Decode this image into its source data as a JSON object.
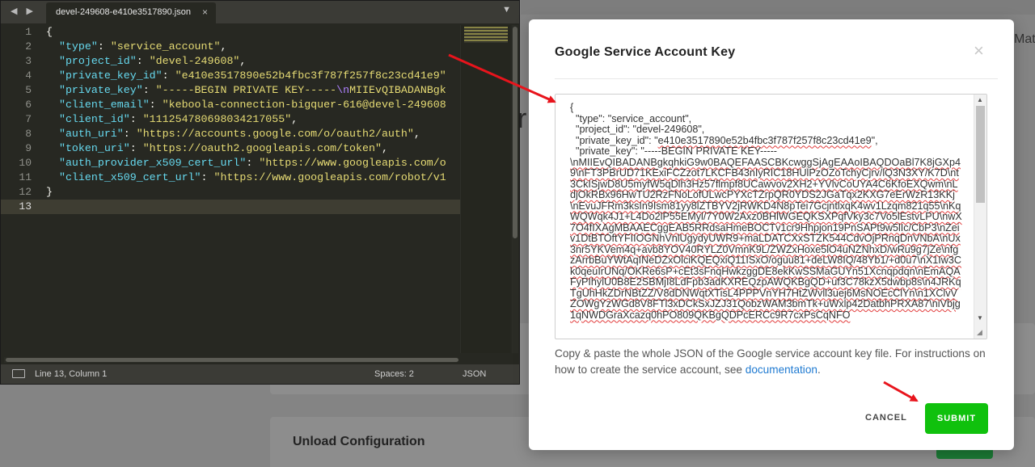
{
  "editor": {
    "tab_title": "devel-249608-e410e3517890.json",
    "tab_close": "×",
    "nav_arrows": "◀ ▶",
    "menu_icon": "▼",
    "line_numbers": [
      "1",
      "2",
      "3",
      "4",
      "5",
      "6",
      "7",
      "8",
      "9",
      "10",
      "11",
      "12",
      "13"
    ],
    "lines": [
      [
        {
          "t": "{",
          "c": "p"
        }
      ],
      [
        {
          "t": "  \"type\"",
          "c": "k"
        },
        {
          "t": ": ",
          "c": "p"
        },
        {
          "t": "\"service_account\"",
          "c": "s"
        },
        {
          "t": ",",
          "c": "p"
        }
      ],
      [
        {
          "t": "  \"project_id\"",
          "c": "k"
        },
        {
          "t": ": ",
          "c": "p"
        },
        {
          "t": "\"devel-249608\"",
          "c": "s"
        },
        {
          "t": ",",
          "c": "p"
        }
      ],
      [
        {
          "t": "  \"private_key_id\"",
          "c": "k"
        },
        {
          "t": ": ",
          "c": "p"
        },
        {
          "t": "\"e410e3517890e52b4fbc3f787f257f8c23cd41e9\"",
          "c": "s"
        }
      ],
      [
        {
          "t": "  \"private_key\"",
          "c": "k"
        },
        {
          "t": ": ",
          "c": "p"
        },
        {
          "t": "\"-----BEGIN PRIVATE KEY-----",
          "c": "s"
        },
        {
          "t": "\\n",
          "c": "esc"
        },
        {
          "t": "MIIEvQIBADANBgk",
          "c": "s"
        }
      ],
      [
        {
          "t": "  \"client_email\"",
          "c": "k"
        },
        {
          "t": ": ",
          "c": "p"
        },
        {
          "t": "\"keboola-connection-bigquer-616@devel-249608",
          "c": "s"
        }
      ],
      [
        {
          "t": "  \"client_id\"",
          "c": "k"
        },
        {
          "t": ": ",
          "c": "p"
        },
        {
          "t": "\"111254780698034217055\"",
          "c": "s"
        },
        {
          "t": ",",
          "c": "p"
        }
      ],
      [
        {
          "t": "  \"auth_uri\"",
          "c": "k"
        },
        {
          "t": ": ",
          "c": "p"
        },
        {
          "t": "\"https://accounts.google.com/o/oauth2/auth\"",
          "c": "s"
        },
        {
          "t": ",",
          "c": "p"
        }
      ],
      [
        {
          "t": "  \"token_uri\"",
          "c": "k"
        },
        {
          "t": ": ",
          "c": "p"
        },
        {
          "t": "\"https://oauth2.googleapis.com/token\"",
          "c": "s"
        },
        {
          "t": ",",
          "c": "p"
        }
      ],
      [
        {
          "t": "  \"auth_provider_x509_cert_url\"",
          "c": "k"
        },
        {
          "t": ": ",
          "c": "p"
        },
        {
          "t": "\"https://www.googleapis.com/o",
          "c": "s"
        }
      ],
      [
        {
          "t": "  \"client_x509_cert_url\"",
          "c": "k"
        },
        {
          "t": ": ",
          "c": "p"
        },
        {
          "t": "\"https://www.googleapis.com/robot/v1",
          "c": "s"
        }
      ],
      [
        {
          "t": "}",
          "c": "p"
        }
      ],
      [
        {
          "t": "",
          "c": "p"
        }
      ]
    ],
    "status": {
      "position": "Line 13, Column 1",
      "spaces": "Spaces: 2",
      "syntax": "JSON"
    }
  },
  "background": {
    "section_title": "Unload Configuration",
    "tab_fragment": "Mat",
    "glyph": "r"
  },
  "modal": {
    "title": "Google Service Account Key",
    "close_icon": "×",
    "json_lines": [
      {
        "t": "{"
      },
      {
        "t": "  \"type\": \"service_account\","
      },
      {
        "t": "  \"project_id\": \"devel-249608\","
      },
      {
        "t": "  \"private_key_id\": \"",
        "u": "e410e3517890e52b4fbc3f787f257f8c23cd41e9",
        "e": "\","
      },
      {
        "t": "  \"private_key\": \"-----BEGIN PRIVATE KEY-----"
      },
      {
        "u": "\\nMIIEvQIBADANBgkqhkiG9w0BAQEFAASCBKcwggSjAgEAAoIBAQDOaBl7K8jGXp49\\nFT3PBrUD71KExiFCZzot7LKCFB43nIyRIC18HUlPzOZoTchyCjrv/lQ3N3XY/K7D\\nt3CkISjwD8U5myfW5qDlh3Hz57flmpf8UCawvov2XH2+YVlvCoUYA4C6KfoEXQwm\\nLdjOkRBx96HwTU2RzFNoLofULwcPYXcTZrpQR0YDS2JGaTqx2KXG7eErWzR13KKj\\nEvuJFRm3ksIn9Ism81yy8lZTBYV2jRWKD4N8pTei7GcjntlxqK4wv1Lzqm821q55\\nKqWQWqk4J1+L4Do2lP55EMyl/7Y0W2Axz0BHlWGEQKSXPqfVky3c7Vo5lEstvLPU\\nwX7O4fIXAgMBAAECggEAB5RRdsaHmeBOCTv1cr9Hhpjon19PnSAPt9w5lIc/CbP3\\nZeiv1DtBTOftYFIIOGNhVnlUgydyUWR9+maLDATCXxSTZK544CdvOjPRnqDnVNbA\\nUx3nr5YKVem4q+avb8YOV40RYLZ0VmnK9L/ZWZxHoxe5lO4uNZNhxD/wRu9g7jZe\\nfgzArrbBuYWtAqINeDZxOlciKQEQxiQ11ISxO/oguu81+deLW8IQ/48Yb1/+d0u7\\nX1Iw3Ck0qeuIrUNq/OKRe6sP+cEt3sFnqHwkzggDE8ekKwSSMaGUYn51Xcnqpdqn\\nEmAQAFyPIhylU0B8E2SBMjI8LdFpb3adKXREQzpAWQKBgQD+uf3C78kzX5dwbp8s\\n4JRKqTgUhHkZDrNBtZZ/V8dDNWqtXTisL4PPPVnYH7HtZWvll3uej6MsNOEcClYn\\n1XClvVZOWgYzWGd8V8FTl3xDCkSxJZJ31QobzWAM3bmTk+uWxlp42DatbhPRXA87\\niVbjg1qNWDGraXcazq0hPO809QKBgQDPcERCc9R7cxPsCqNFO"
      }
    ],
    "help_text": "Copy & paste the whole JSON of the Google service account key file. For instructions on how to create the service account, see ",
    "help_link": "documentation",
    "help_end": ".",
    "cancel_label": "CANCEL",
    "submit_label": "SUBMIT"
  },
  "colors": {
    "submit": "#10c10d",
    "link": "#1f7ad1",
    "arrow": "#e8141c",
    "editor_bg": "#272822"
  }
}
